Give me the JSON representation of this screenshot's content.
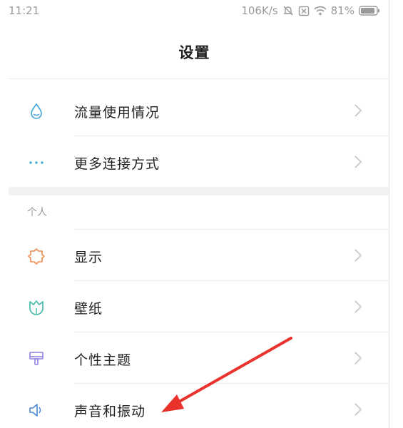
{
  "status_bar": {
    "time": "11:21",
    "net_speed": "106K/s",
    "battery": "81%"
  },
  "header": {
    "title": "设置"
  },
  "connection_items": [
    {
      "label": "流量使用情况",
      "icon": "water-drop-icon",
      "icon_color": "#4aa6d6"
    },
    {
      "label": "更多连接方式",
      "icon": "more-dots-icon",
      "icon_color": "#3cb0c8"
    }
  ],
  "personal_section": {
    "header": "个人",
    "items": [
      {
        "label": "显示",
        "icon": "sun-icon",
        "icon_color": "#f08a4b"
      },
      {
        "label": "壁纸",
        "icon": "wallpaper-tulip-icon",
        "icon_color": "#3fb6a8"
      },
      {
        "label": "个性主题",
        "icon": "theme-brush-icon",
        "icon_color": "#8f7fe0"
      },
      {
        "label": "声音和振动",
        "icon": "speaker-icon",
        "icon_color": "#4a86d6"
      }
    ]
  },
  "annotation": {
    "arrow_color": "#e8322b"
  }
}
